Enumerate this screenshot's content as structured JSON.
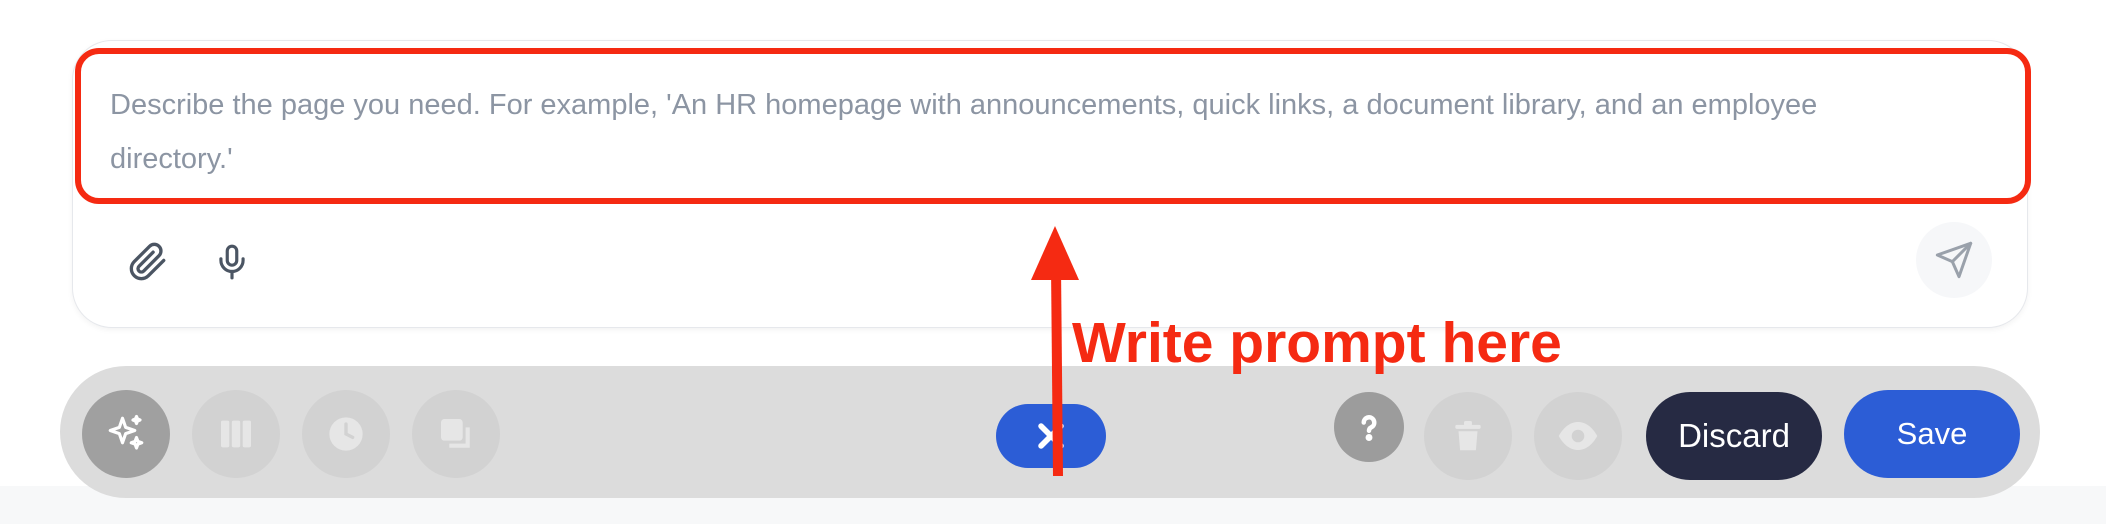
{
  "prompt": {
    "placeholder": "Describe the page you need. For example, 'An HR homepage with announcements, quick links, a document library, and an employee directory.'",
    "value": "",
    "tools": [
      {
        "icon": "paperclip-icon",
        "label": "Attach"
      },
      {
        "icon": "microphone-icon",
        "label": "Voice input"
      }
    ],
    "send_icon": "send-icon"
  },
  "toolbar": {
    "left_buttons": [
      {
        "icon": "sparkles-icon",
        "active": true
      },
      {
        "icon": "columns-icon",
        "active": false
      },
      {
        "icon": "clock-icon",
        "active": false
      },
      {
        "icon": "copy-icon",
        "active": false
      }
    ],
    "center_toggle_icon": "close-icon",
    "right_buttons": [
      {
        "icon": "help-icon"
      },
      {
        "icon": "trash-icon"
      },
      {
        "icon": "eye-icon"
      }
    ],
    "discard_label": "Discard",
    "save_label": "Save"
  },
  "annotation": {
    "text": "Write prompt here",
    "color": "#f52a12"
  },
  "colors": {
    "accent_blue": "#2c5dd6",
    "discard_dark": "#262a43",
    "highlight_red": "#f52a12",
    "toolbar_bg": "#dcdcdc"
  }
}
